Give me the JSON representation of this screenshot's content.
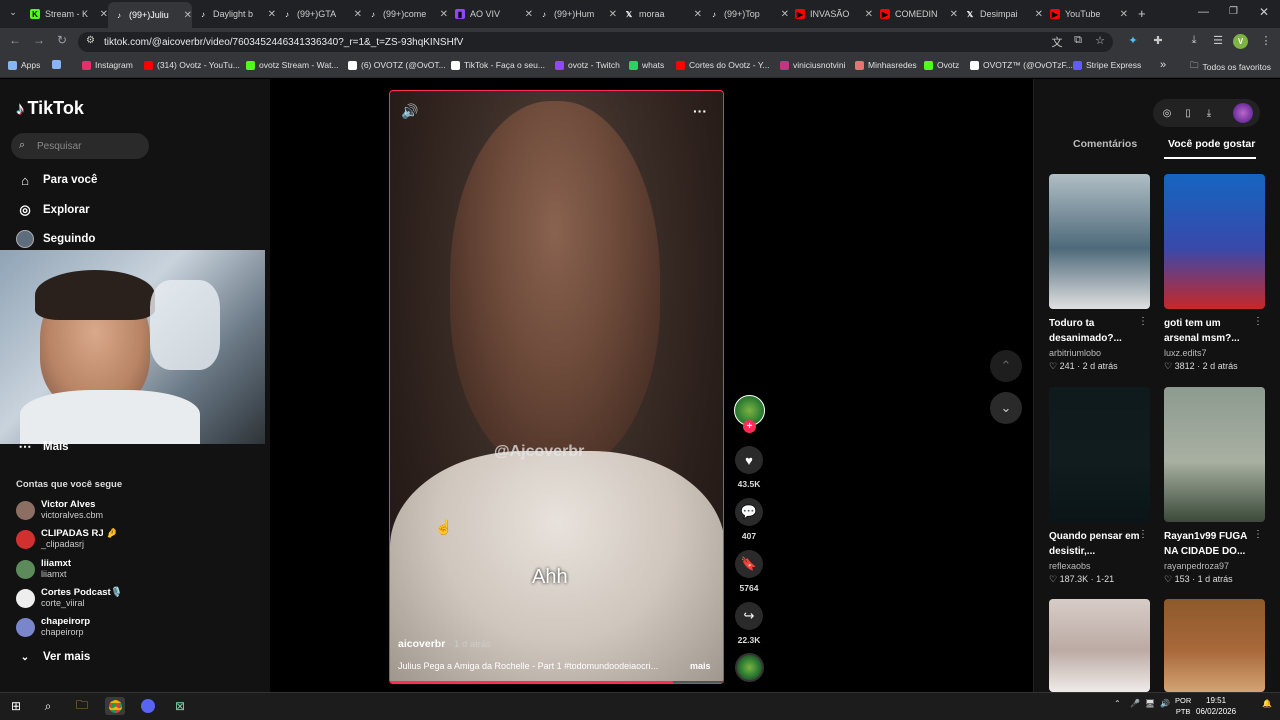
{
  "browser": {
    "tabs": [
      {
        "label": "Stream - K",
        "icon": "kick-icon",
        "color": "#53fc18"
      },
      {
        "label": "(99+)Juliu",
        "icon": "tiktok-icon",
        "color": "#ffffff",
        "active": true
      },
      {
        "label": "Daylight b",
        "icon": "tiktok-icon",
        "color": "#ffffff"
      },
      {
        "label": "(99+)GTA",
        "icon": "tiktok-icon",
        "color": "#ffffff"
      },
      {
        "label": "(99+)come",
        "icon": "tiktok-icon",
        "color": "#ffffff"
      },
      {
        "label": "AO VIV",
        "icon": "twitch-icon",
        "color": "#9146ff"
      },
      {
        "label": "(99+)Hum",
        "icon": "tiktok-icon",
        "color": "#ffffff"
      },
      {
        "label": "moraa",
        "icon": "x-icon",
        "color": "#ffffff"
      },
      {
        "label": "(99+)Top",
        "icon": "tiktok-icon",
        "color": "#ffffff"
      },
      {
        "label": "INVASÃO",
        "icon": "youtube-icon",
        "color": "#ff0000"
      },
      {
        "label": "COMEDIN",
        "icon": "youtube-icon",
        "color": "#ff0000"
      },
      {
        "label": "Desimpai",
        "icon": "x-icon",
        "color": "#ffffff"
      },
      {
        "label": "YouTube",
        "icon": "youtube-icon",
        "color": "#ff0000"
      }
    ],
    "new_tab": "+",
    "url": "tiktok.com/@aicoverbr/video/7603452446341336340?_r=1&_t=ZS-93hqKINSHfV",
    "bookmarks": [
      {
        "label": "Apps",
        "color": "#8ab4f8"
      },
      {
        "label": "",
        "color": "#8ab4f8"
      },
      {
        "label": "Instagram",
        "color": "#e1306c"
      },
      {
        "label": "(314) Ovotz - YouTu...",
        "color": "#ff0000"
      },
      {
        "label": "ovotz Stream - Wat...",
        "color": "#53fc18"
      },
      {
        "label": "(6) OVOTZ (@OvOT...",
        "color": "#ffffff"
      },
      {
        "label": "TikTok - Faça o seu...",
        "color": "#ffffff"
      },
      {
        "label": "ovotz - Twitch",
        "color": "#9146ff"
      },
      {
        "label": "whats",
        "color": "#25d366"
      },
      {
        "label": "Cortes do Ovotz - Y...",
        "color": "#ff0000"
      },
      {
        "label": "viniciusnotvini",
        "color": "#c13584"
      },
      {
        "label": "Minhasredes",
        "color": "#e57373"
      },
      {
        "label": "Ovotz",
        "color": "#53fc18"
      },
      {
        "label": "OVOTZ™ (@OvOTzF...",
        "color": "#ffffff"
      },
      {
        "label": "Stripe Express",
        "color": "#635bff"
      }
    ],
    "bookmarks_more": "»",
    "all_bookmarks": "Todos os favoritos",
    "profile_initial": "V"
  },
  "tiktok": {
    "logo": "TikTok",
    "search_placeholder": "Pesquisar",
    "nav": [
      {
        "label": "Para você",
        "icon": "home-icon"
      },
      {
        "label": "Explorar",
        "icon": "compass-icon"
      },
      {
        "label": "Seguindo",
        "icon": "following-icon"
      }
    ],
    "more": "Mais",
    "following_header": "Contas que você segue",
    "following": [
      {
        "name": "Victor Alves",
        "handle": "victoralves.cbm",
        "color": "#8d6e63"
      },
      {
        "name": "CLIPADAS RJ 🤌",
        "handle": "_clipadasrj",
        "color": "#d32f2f"
      },
      {
        "name": "liiamxt",
        "handle": "liiamxt",
        "color": "#5d8a5a"
      },
      {
        "name": "Cortes Podcast🎙️",
        "handle": "corte_viiral",
        "color": "#eeeeee"
      },
      {
        "name": "chapeirorp",
        "handle": "chapeirorp",
        "color": "#7986cb"
      }
    ],
    "see_more": "Ver mais"
  },
  "video": {
    "watermark": "@Ajcoverbr",
    "subtitle": "Ahh",
    "author": "aicoverbr",
    "posted": "· 1 d atrás",
    "description": "Julius Pega a Amiga da Rochelle - Part 1 #todomundoodeiaocri...",
    "more": "mais",
    "progress": 0.85,
    "likes": "43.5K",
    "comments": "407",
    "saves": "5764",
    "shares": "22.3K",
    "follow_plus": "+"
  },
  "right_panel": {
    "tabs": [
      "Comentários",
      "Você pode gostar"
    ],
    "active_tab": "Você pode gostar",
    "cards": [
      {
        "title": "Toduro ta desanimado?...",
        "author": "arbitriumlobo",
        "likes": "241",
        "age": "2 d atrás",
        "colors": [
          "#b0bec5",
          "#4e6a7a",
          "#e0e0e0"
        ]
      },
      {
        "title": "goti tem um arsenal msm?...",
        "author": "luxz.edits7",
        "likes": "3812",
        "age": "2 d atrás",
        "colors": [
          "#1565c0",
          "#3949ab",
          "#c62828"
        ]
      },
      {
        "title": "Quando pensar em desistir,...",
        "author": "reflexaobs",
        "likes": "187.3K",
        "age": "1-21",
        "colors": [
          "#0e1a1c",
          "#101c1e",
          "#0b1517"
        ]
      },
      {
        "title": "Rayan1v99 FUGA NA CIDADE DO...",
        "author": "rayanpedroza97",
        "likes": "153",
        "age": "1 d atrás",
        "colors": [
          "#8d9a8f",
          "#a8b0a2",
          "#3b4a3a"
        ]
      },
      {
        "title": "",
        "author": "",
        "likes": "",
        "age": "",
        "colors": [
          "#d7ccc8",
          "#bcaaa4",
          "#efebe9"
        ]
      },
      {
        "title": "",
        "author": "",
        "likes": "",
        "age": "",
        "colors": [
          "#8d5a2b",
          "#a8683a",
          "#d4a373"
        ]
      }
    ]
  },
  "taskbar": {
    "lang_top": "POR",
    "lang_bottom": "PTB",
    "time": "19:51",
    "date": "06/02/2026"
  }
}
